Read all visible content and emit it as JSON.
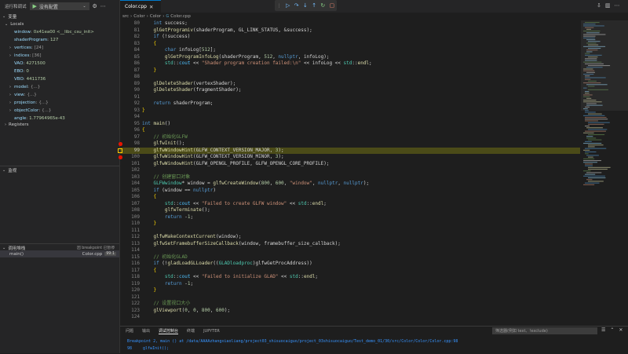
{
  "sidebar": {
    "run_title": "运行和调试",
    "config_label": "没有配置",
    "variables_header": "变量",
    "locals_label": "Locals",
    "locals": [
      {
        "name": "window",
        "value": "0x41ea00 <__libc_csu_init>",
        "expandable": false
      },
      {
        "name": "shaderProgram",
        "value": "127",
        "expandable": false
      },
      {
        "name": "vertices",
        "value": "[24]",
        "expandable": true
      },
      {
        "name": "indices",
        "value": "[36]",
        "expandable": true
      },
      {
        "name": "VAO",
        "value": "4271500",
        "expandable": false
      },
      {
        "name": "EBO",
        "value": "0",
        "expandable": false
      },
      {
        "name": "VBO",
        "value": "4411736",
        "expandable": false
      },
      {
        "name": "model",
        "value": "{...}",
        "expandable": true
      },
      {
        "name": "view",
        "value": "{...}",
        "expandable": true
      },
      {
        "name": "projection",
        "value": "{...}",
        "expandable": true
      },
      {
        "name": "objectColor",
        "value": "{...}",
        "expandable": true
      },
      {
        "name": "angle",
        "value": "1.77964965e-43",
        "expandable": false
      }
    ],
    "registers_label": "Registers",
    "watch_header": "监视",
    "callstack_header": "调用堆栈",
    "callstack_status": "因 breakpoint 已暂停",
    "frame": {
      "name": "main()",
      "file": "Color.cpp",
      "line": "99:1"
    }
  },
  "tab": {
    "filename": "Color.cpp"
  },
  "breadcrumb": [
    "src",
    "Color",
    "Color",
    "Color.cpp"
  ],
  "editor": {
    "current_line": 99,
    "breakpoint_lines": [
      98,
      100
    ],
    "lines": [
      {
        "n": 80,
        "tokens": [
          [
            "pl",
            "    "
          ],
          [
            "kw",
            "int"
          ],
          [
            "pl",
            " success;"
          ]
        ]
      },
      {
        "n": 81,
        "tokens": [
          [
            "pl",
            "    "
          ],
          [
            "fn",
            "glGetProgramiv"
          ],
          [
            "pl",
            "(shaderProgram, GL_LINK_STATUS, &success);"
          ]
        ]
      },
      {
        "n": 82,
        "tokens": [
          [
            "pl",
            "    "
          ],
          [
            "kw",
            "if"
          ],
          [
            "pl",
            " (!success)"
          ]
        ]
      },
      {
        "n": 83,
        "tokens": [
          [
            "pl",
            "    "
          ],
          [
            "br",
            "{"
          ]
        ]
      },
      {
        "n": 84,
        "tokens": [
          [
            "pl",
            "        "
          ],
          [
            "kw",
            "char"
          ],
          [
            "pl",
            " infoLog["
          ],
          [
            "nu",
            "512"
          ],
          [
            "pl",
            "];"
          ]
        ]
      },
      {
        "n": 85,
        "tokens": [
          [
            "pl",
            "        "
          ],
          [
            "fn",
            "glGetProgramInfoLog"
          ],
          [
            "pl",
            "(shaderProgram, "
          ],
          [
            "nu",
            "512"
          ],
          [
            "pl",
            ", "
          ],
          [
            "kw",
            "nullptr"
          ],
          [
            "pl",
            ", infoLog);"
          ]
        ]
      },
      {
        "n": 86,
        "tokens": [
          [
            "pl",
            "        "
          ],
          [
            "ty",
            "std"
          ],
          [
            "pl",
            "::"
          ],
          [
            "mc",
            "cout"
          ],
          [
            "pl",
            " << "
          ],
          [
            "st",
            "\"Shader program creation failed:\\n\""
          ],
          [
            "pl",
            " << infoLog << "
          ],
          [
            "ty",
            "std"
          ],
          [
            "pl",
            "::"
          ],
          [
            "fn",
            "endl"
          ],
          [
            "pl",
            ";"
          ]
        ]
      },
      {
        "n": 87,
        "tokens": [
          [
            "pl",
            "    "
          ],
          [
            "br",
            "}"
          ]
        ]
      },
      {
        "n": 88,
        "tokens": []
      },
      {
        "n": 89,
        "tokens": [
          [
            "pl",
            "    "
          ],
          [
            "fn",
            "glDeleteShader"
          ],
          [
            "pl",
            "(vertexShader);"
          ]
        ]
      },
      {
        "n": 90,
        "tokens": [
          [
            "pl",
            "    "
          ],
          [
            "fn",
            "glDeleteShader"
          ],
          [
            "pl",
            "(fragmentShader);"
          ]
        ]
      },
      {
        "n": 91,
        "tokens": []
      },
      {
        "n": 92,
        "tokens": [
          [
            "pl",
            "    "
          ],
          [
            "kw",
            "return"
          ],
          [
            "pl",
            " shaderProgram;"
          ]
        ]
      },
      {
        "n": 93,
        "tokens": [
          [
            "br",
            "}"
          ]
        ]
      },
      {
        "n": 94,
        "tokens": []
      },
      {
        "n": 95,
        "tokens": [
          [
            "kw",
            "int"
          ],
          [
            "pl",
            " "
          ],
          [
            "fn",
            "main"
          ],
          [
            "pl",
            "()"
          ]
        ]
      },
      {
        "n": 96,
        "tokens": [
          [
            "br",
            "{"
          ]
        ]
      },
      {
        "n": 97,
        "tokens": [
          [
            "pl",
            "    "
          ],
          [
            "cm",
            "// 初始化GLFW"
          ]
        ]
      },
      {
        "n": 98,
        "tokens": [
          [
            "pl",
            "    "
          ],
          [
            "fn",
            "glfwInit"
          ],
          [
            "pl",
            "();"
          ]
        ]
      },
      {
        "n": 99,
        "tokens": [
          [
            "pl",
            "    "
          ],
          [
            "fn",
            "glfwWindowHint"
          ],
          [
            "pl",
            "(GLFW_CONTEXT_VERSION_MAJOR, "
          ],
          [
            "nu",
            "3"
          ],
          [
            "pl",
            ");"
          ]
        ]
      },
      {
        "n": 100,
        "tokens": [
          [
            "pl",
            "    "
          ],
          [
            "fn",
            "glfwWindowHint"
          ],
          [
            "pl",
            "(GLFW_CONTEXT_VERSION_MINOR, "
          ],
          [
            "nu",
            "3"
          ],
          [
            "pl",
            ");"
          ]
        ]
      },
      {
        "n": 101,
        "tokens": [
          [
            "pl",
            "    "
          ],
          [
            "fn",
            "glfwWindowHint"
          ],
          [
            "pl",
            "(GLFW_OPENGL_PROFILE, GLFW_OPENGL_CORE_PROFILE);"
          ]
        ]
      },
      {
        "n": 102,
        "tokens": []
      },
      {
        "n": 103,
        "tokens": [
          [
            "pl",
            "    "
          ],
          [
            "cm",
            "// 创建窗口对象"
          ]
        ]
      },
      {
        "n": 104,
        "tokens": [
          [
            "pl",
            "    "
          ],
          [
            "ty",
            "GLFWwindow"
          ],
          [
            "pl",
            "* window = "
          ],
          [
            "fn",
            "glfwCreateWindow"
          ],
          [
            "pl",
            "("
          ],
          [
            "nu",
            "800"
          ],
          [
            "pl",
            ", "
          ],
          [
            "nu",
            "600"
          ],
          [
            "pl",
            ", "
          ],
          [
            "st",
            "\"window\""
          ],
          [
            "pl",
            ", "
          ],
          [
            "kw",
            "nullptr"
          ],
          [
            "pl",
            ", "
          ],
          [
            "kw",
            "nullptr"
          ],
          [
            "pl",
            ");"
          ]
        ]
      },
      {
        "n": 105,
        "tokens": [
          [
            "pl",
            "    "
          ],
          [
            "kw",
            "if"
          ],
          [
            "pl",
            " (window == "
          ],
          [
            "kw",
            "nullptr"
          ],
          [
            "pl",
            ")"
          ]
        ]
      },
      {
        "n": 106,
        "tokens": [
          [
            "pl",
            "    "
          ],
          [
            "br",
            "{"
          ]
        ]
      },
      {
        "n": 107,
        "tokens": [
          [
            "pl",
            "        "
          ],
          [
            "ty",
            "std"
          ],
          [
            "pl",
            "::"
          ],
          [
            "mc",
            "cout"
          ],
          [
            "pl",
            " << "
          ],
          [
            "st",
            "\"Failed to create GLFW window\""
          ],
          [
            "pl",
            " << "
          ],
          [
            "ty",
            "std"
          ],
          [
            "pl",
            "::"
          ],
          [
            "fn",
            "endl"
          ],
          [
            "pl",
            ";"
          ]
        ]
      },
      {
        "n": 108,
        "tokens": [
          [
            "pl",
            "        "
          ],
          [
            "fn",
            "glfwTerminate"
          ],
          [
            "pl",
            "();"
          ]
        ]
      },
      {
        "n": 109,
        "tokens": [
          [
            "pl",
            "        "
          ],
          [
            "kw",
            "return"
          ],
          [
            "pl",
            " -"
          ],
          [
            "nu",
            "1"
          ],
          [
            "pl",
            ";"
          ]
        ]
      },
      {
        "n": 110,
        "tokens": [
          [
            "pl",
            "    "
          ],
          [
            "br",
            "}"
          ]
        ]
      },
      {
        "n": 111,
        "tokens": []
      },
      {
        "n": 112,
        "tokens": [
          [
            "pl",
            "    "
          ],
          [
            "fn",
            "glfwMakeContextCurrent"
          ],
          [
            "pl",
            "(window);"
          ]
        ]
      },
      {
        "n": 113,
        "tokens": [
          [
            "pl",
            "    "
          ],
          [
            "fn",
            "glfwSetFramebufferSizeCallback"
          ],
          [
            "pl",
            "(window, framebuffer_size_callback);"
          ]
        ]
      },
      {
        "n": 114,
        "tokens": []
      },
      {
        "n": 115,
        "tokens": [
          [
            "pl",
            "    "
          ],
          [
            "cm",
            "// 初始化GLAD"
          ]
        ]
      },
      {
        "n": 116,
        "tokens": [
          [
            "pl",
            "    "
          ],
          [
            "kw",
            "if"
          ],
          [
            "pl",
            " (!"
          ],
          [
            "fn",
            "gladLoadGLLoader"
          ],
          [
            "pl",
            "(("
          ],
          [
            "ty",
            "GLADloadproc"
          ],
          [
            "pl",
            ")glfwGetProcAddress))"
          ]
        ]
      },
      {
        "n": 117,
        "tokens": [
          [
            "pl",
            "    "
          ],
          [
            "br",
            "{"
          ]
        ]
      },
      {
        "n": 118,
        "tokens": [
          [
            "pl",
            "        "
          ],
          [
            "ty",
            "std"
          ],
          [
            "pl",
            "::"
          ],
          [
            "mc",
            "cout"
          ],
          [
            "pl",
            " << "
          ],
          [
            "st",
            "\"Failed to initialize GLAD\""
          ],
          [
            "pl",
            " << "
          ],
          [
            "ty",
            "std"
          ],
          [
            "pl",
            "::"
          ],
          [
            "fn",
            "endl"
          ],
          [
            "pl",
            ";"
          ]
        ]
      },
      {
        "n": 119,
        "tokens": [
          [
            "pl",
            "        "
          ],
          [
            "kw",
            "return"
          ],
          [
            "pl",
            " -"
          ],
          [
            "nu",
            "1"
          ],
          [
            "pl",
            ";"
          ]
        ]
      },
      {
        "n": 120,
        "tokens": [
          [
            "pl",
            "    "
          ],
          [
            "br",
            "}"
          ]
        ]
      },
      {
        "n": 121,
        "tokens": []
      },
      {
        "n": 122,
        "tokens": [
          [
            "pl",
            "    "
          ],
          [
            "cm",
            "// 设置视口大小"
          ]
        ]
      },
      {
        "n": 123,
        "tokens": [
          [
            "pl",
            "    "
          ],
          [
            "fn",
            "glViewport"
          ],
          [
            "pl",
            "("
          ],
          [
            "nu",
            "0"
          ],
          [
            "pl",
            ", "
          ],
          [
            "nu",
            "0"
          ],
          [
            "pl",
            ", "
          ],
          [
            "nu",
            "800"
          ],
          [
            "pl",
            ", "
          ],
          [
            "nu",
            "600"
          ],
          [
            "pl",
            ");"
          ]
        ]
      },
      {
        "n": 124,
        "tokens": []
      }
    ]
  },
  "panel": {
    "tabs": [
      "问题",
      "输出",
      "调试控制台",
      "终端",
      "JUPYTER"
    ],
    "active_tab": "调试控制台",
    "filter_placeholder": "筛选器(例如 text、!exclude)",
    "console_line1": "Breakpoint 2, main () at /data/AAAAzhangxiaoliang/project03_shisuocaiguo/project_03shisuocaiguo/Test_demo_01/30/src/Color/Color/Color.cpp:98",
    "console_line2_num": "98",
    "console_line2_code": "glfwInit();"
  },
  "colors": {
    "accent": "#007acc",
    "breakpoint": "#e51400",
    "current_line_bg": "#4b4b18"
  }
}
